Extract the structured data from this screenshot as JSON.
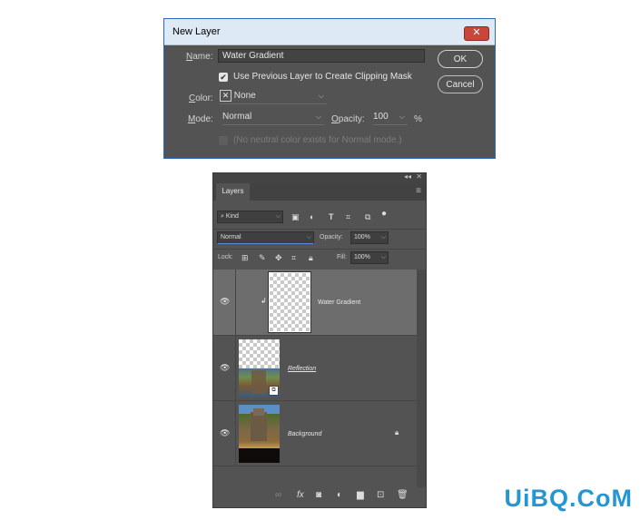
{
  "dialog": {
    "title": "New Layer",
    "close_glyph": "✕",
    "name_label_key": "N",
    "name_label_rest": "ame:",
    "name_value": "Water Gradient",
    "clip_checked": true,
    "clip_label": "Use Previous Layer to Create Clipping Mask",
    "color_label_key": "C",
    "color_label_rest": "olor:",
    "color_value": "None",
    "mode_label_key": "M",
    "mode_label_rest": "ode:",
    "mode_value": "Normal",
    "opacity_label_key": "O",
    "opacity_label_rest": "pacity:",
    "opacity_value": "100",
    "opacity_unit": "%",
    "neutral_note": "(No neutral color exists for Normal mode.)",
    "ok_label": "OK",
    "cancel_label": "Cancel"
  },
  "layers_panel": {
    "tab_label": "Layers",
    "collapse_glyph": "◂◂",
    "close_glyph": "✕",
    "filter_label": "Kind",
    "blend_mode": "Normal",
    "opacity_label": "Opacity:",
    "opacity_value": "100%",
    "lock_label": "Lock:",
    "fill_label": "Fill:",
    "fill_value": "100%",
    "layers": [
      {
        "name": "Water Gradient",
        "selected": true
      },
      {
        "name": "Reflection",
        "selected": false
      },
      {
        "name": "Background",
        "selected": false
      }
    ]
  },
  "watermark": "UiBQ.CoM"
}
